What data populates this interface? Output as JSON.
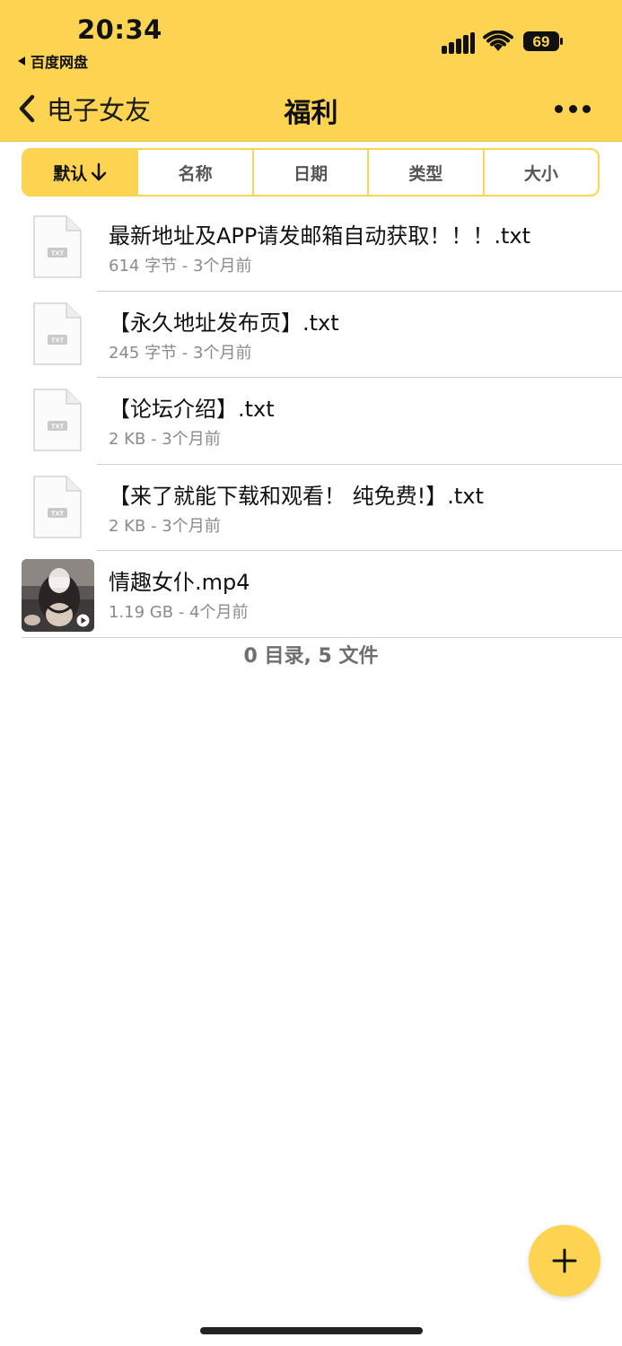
{
  "status_bar": {
    "time": "20:34",
    "back_app": "百度网盘",
    "battery": "69"
  },
  "nav": {
    "back_label": "电子女友",
    "title": "福利"
  },
  "sort_tabs": [
    {
      "label": "默认",
      "active": true
    },
    {
      "label": "名称",
      "active": false
    },
    {
      "label": "日期",
      "active": false
    },
    {
      "label": "类型",
      "active": false
    },
    {
      "label": "大小",
      "active": false
    }
  ],
  "files": [
    {
      "name": "最新地址及APP请发邮箱自动获取！！！.txt",
      "meta": "614 字节 - 3个月前",
      "type": "txt",
      "icon_text": "TXT"
    },
    {
      "name": "【永久地址发布页】.txt",
      "meta": "245 字节 - 3个月前",
      "type": "txt",
      "icon_text": "TXT"
    },
    {
      "name": "【论坛介绍】.txt",
      "meta": "2 KB - 3个月前",
      "type": "txt",
      "icon_text": "TXT"
    },
    {
      "name": "【来了就能下载和观看！ 纯免费!】.txt",
      "meta": "2 KB - 3个月前",
      "type": "txt",
      "icon_text": "TXT"
    },
    {
      "name": "情趣女仆.mp4",
      "meta": "1.19 GB - 4个月前",
      "type": "video"
    }
  ],
  "summary": "0 目录, 5 文件",
  "colors": {
    "accent": "#fdd451",
    "divider": "#cfcfcf",
    "meta_text": "#8a8a8a"
  },
  "icons": [
    "back-chevron-icon",
    "more-icon",
    "signal-icon",
    "wifi-icon",
    "battery-icon",
    "sort-arrow-down-icon",
    "txt-file-icon",
    "play-icon",
    "plus-icon"
  ]
}
